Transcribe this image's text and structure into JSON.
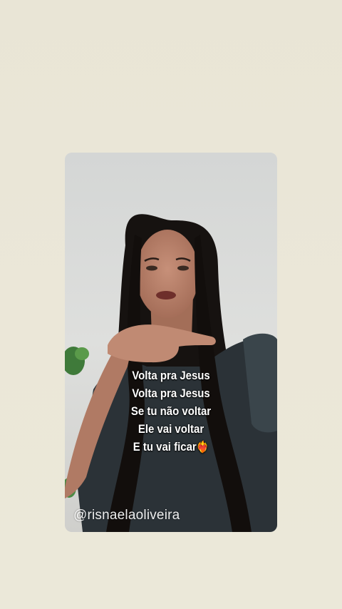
{
  "story": {
    "caption_lines": [
      "Volta pra Jesus",
      "Volta pra Jesus",
      "Se tu não voltar",
      "Ele vai voltar",
      "E tu vai ficar"
    ],
    "caption_emoji": "❤️‍🔥",
    "watermark": "@risnaelaoliveira"
  },
  "colors": {
    "page_background": "#ebe7d8",
    "video_background": "#dcdddb",
    "caption_text": "#ffffff",
    "hair": "#15110f",
    "shirt": "#2c3338",
    "skin": "#b9836c"
  }
}
